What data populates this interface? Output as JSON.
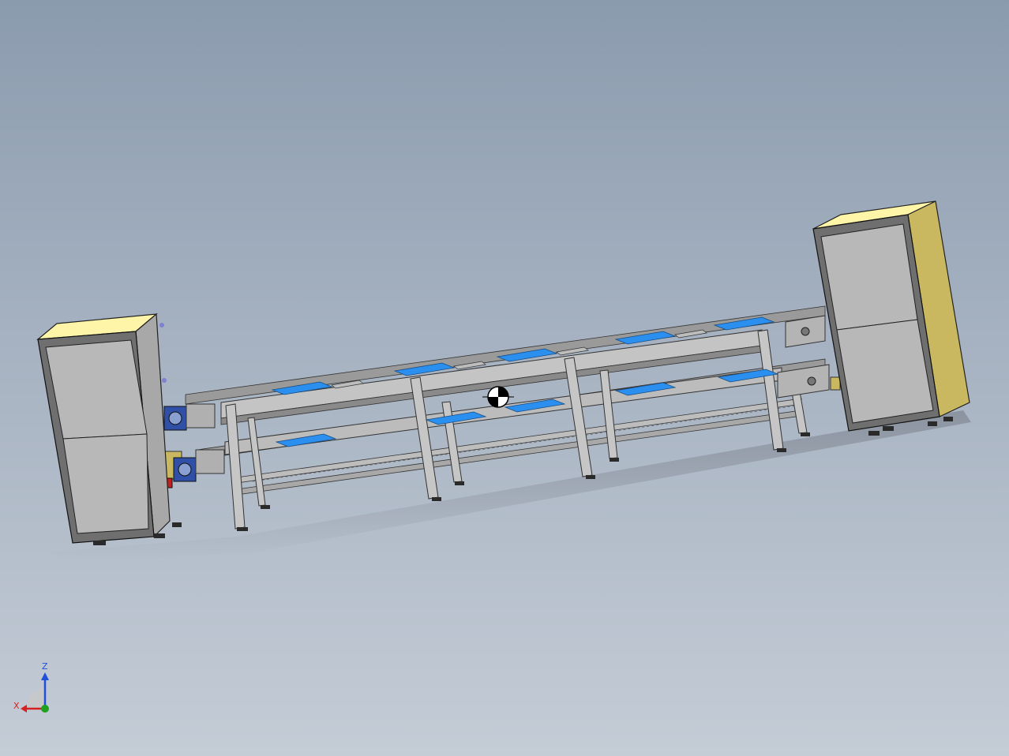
{
  "viewport": {
    "background_top": "#8b9bae",
    "background_bottom": "#c4ccd6"
  },
  "triad": {
    "x_label": "X",
    "z_label": "Z",
    "x_color": "#d82020",
    "y_color": "#20a020",
    "z_color": "#2050d8"
  },
  "model": {
    "cabinet_face_color": "#b8b8b8",
    "cabinet_top_color": "#fff5a8",
    "cabinet_side_color": "#c9b860",
    "frame_color": "#c8c8c8",
    "pallet_color": "#2b8ff0",
    "motor_color": "#3050a8",
    "icons": [
      "center-of-mass-icon"
    ]
  }
}
